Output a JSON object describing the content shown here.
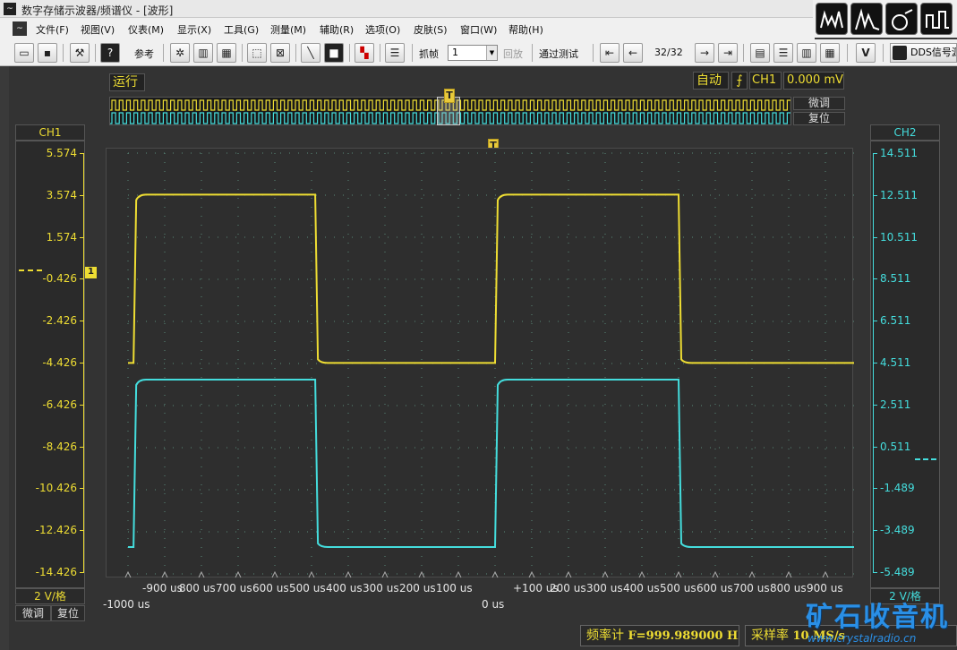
{
  "window": {
    "title": "数字存储示波器/频谱仪 - [波形]",
    "app_icon_glyph": "~"
  },
  "menu": {
    "items": [
      "文件(F)",
      "视图(V)",
      "仪表(M)",
      "显示(X)",
      "工具(G)",
      "测量(M)",
      "辅助(R)",
      "选项(O)",
      "皮肤(S)",
      "窗口(W)",
      "帮助(H)"
    ]
  },
  "toolbar": {
    "reference_label": "参考",
    "capture_label": "抓帧",
    "capture_value": "1",
    "playback_label": "回放",
    "pass_test_label": "通过测试",
    "frame_counter": "32/32",
    "dds_label": "DDS信号源",
    "v_label": "V"
  },
  "status": {
    "run_state": "运行",
    "trigger_mode": "自动",
    "trigger_channel": "CH1",
    "trigger_level": "0.000 mV",
    "fine_tune": "微调",
    "reset": "复位",
    "trigger_marker": "T"
  },
  "channels": {
    "ch1": {
      "name": "CH1",
      "color": "#eedd33",
      "scale": "2 V/格",
      "ticks": [
        "5.574",
        "3.574",
        "1.574",
        "-0.426",
        "-2.426",
        "-4.426",
        "-6.426",
        "-8.426",
        "-10.426",
        "-12.426",
        "-14.426"
      ],
      "ground_marker": "1"
    },
    "ch2": {
      "name": "CH2",
      "color": "#44dddd",
      "scale": "2 V/格",
      "ticks": [
        "14.511",
        "12.511",
        "10.511",
        "8.511",
        "6.511",
        "4.511",
        "2.511",
        "0.511",
        "-1.489",
        "-3.489",
        "-5.489"
      ]
    }
  },
  "ch1_footer": {
    "fine": "微调",
    "reset": "复位"
  },
  "time_axis": {
    "labels": [
      "-900 us",
      "800 us",
      "700 us",
      "600 us",
      "500 us",
      "400 us",
      "300 us",
      "200 us",
      "100 us",
      "+100 us",
      "200 us",
      "300 us",
      "400 us",
      "500 us",
      "600 us",
      "700 us",
      "800 us",
      "900 us"
    ],
    "left_edge": "-1000 us",
    "center": "0 us"
  },
  "measurements": {
    "frequency_label": "频率计",
    "frequency_value": "F=999.989000 Hz",
    "samplerate_label": "采样率",
    "samplerate_value": "10 MS/s"
  },
  "watermark": {
    "text": "矿石收音机",
    "url": "www.crystalradio.cn"
  },
  "chart_data": {
    "type": "line",
    "x_unit": "us",
    "xlim": [
      -1000,
      1000
    ],
    "series": [
      {
        "name": "CH1",
        "color": "#eedd33",
        "axis": "left",
        "high": 3.6,
        "low": -4.4,
        "edges_us": [
          -985,
          -490,
          0,
          500
        ]
      },
      {
        "name": "CH2",
        "color": "#44dddd",
        "axis": "right",
        "high": 3.6,
        "low": -3.8,
        "edges_us": [
          -985,
          -490,
          0,
          500
        ]
      }
    ],
    "y_left_range": [
      -14.426,
      5.574
    ],
    "y_right_range": [
      -5.489,
      14.511
    ],
    "grid": true,
    "divisions": {
      "x": 20,
      "y": 10
    }
  }
}
